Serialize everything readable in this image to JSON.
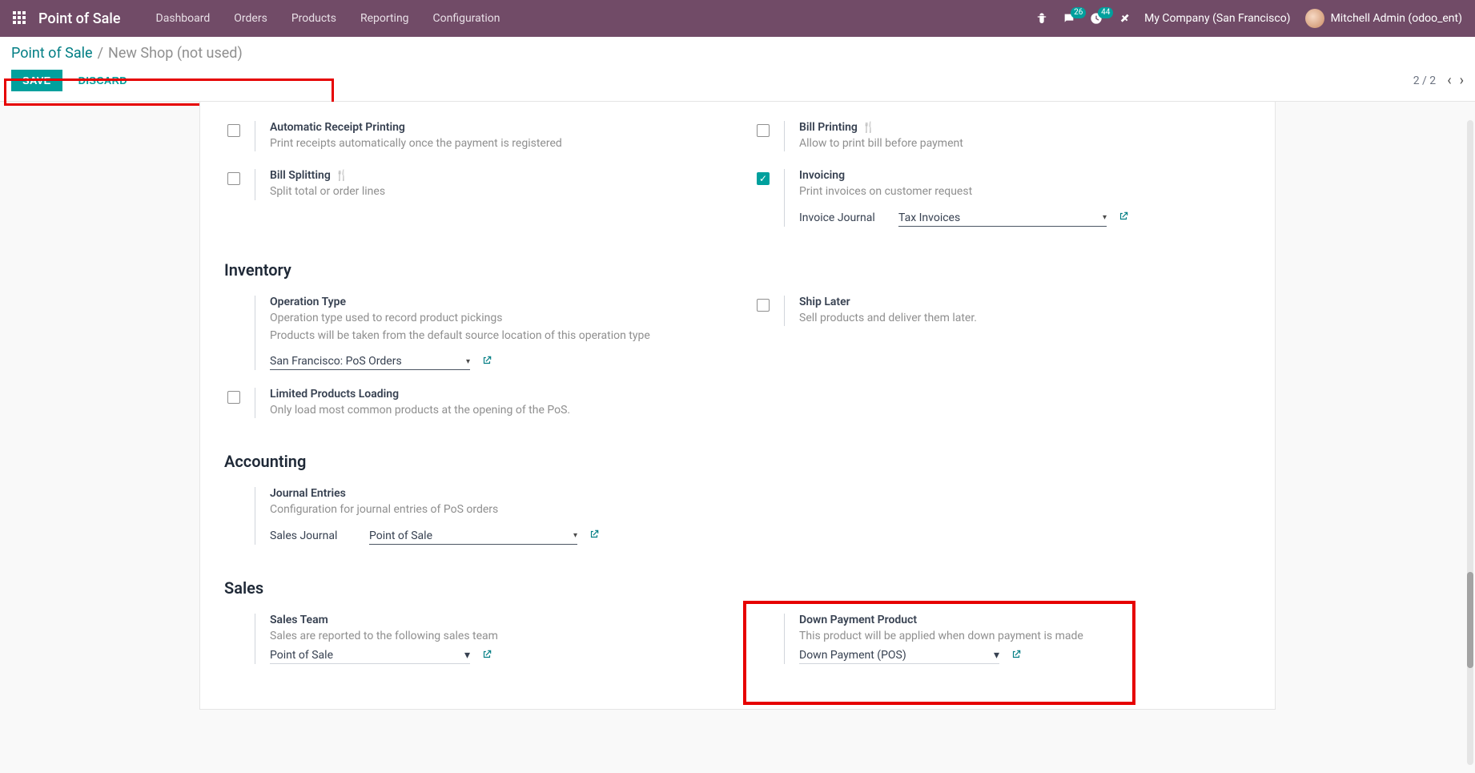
{
  "nav": {
    "brand": "Point of Sale",
    "menu": [
      "Dashboard",
      "Orders",
      "Products",
      "Reporting",
      "Configuration"
    ],
    "msg_count": "26",
    "act_count": "44",
    "company": "My Company (San Francisco)",
    "user": "Mitchell Admin (odoo_ent)"
  },
  "breadcrumb": {
    "root": "Point of Sale",
    "leaf": "New Shop (not used)"
  },
  "buttons": {
    "save": "SAVE",
    "discard": "DISCARD"
  },
  "pager": {
    "text": "2 / 2"
  },
  "settings": {
    "auto_receipt": {
      "title": "Automatic Receipt Printing",
      "desc": "Print receipts automatically once the payment is registered"
    },
    "bill_print": {
      "title": "Bill Printing",
      "desc": "Allow to print bill before payment"
    },
    "bill_split": {
      "title": "Bill Splitting",
      "desc": "Split total or order lines"
    },
    "invoicing": {
      "title": "Invoicing",
      "desc": "Print invoices on customer request",
      "journal_label": "Invoice Journal",
      "journal_value": "Tax Invoices"
    },
    "sections": {
      "inventory": "Inventory",
      "accounting": "Accounting",
      "sales": "Sales"
    },
    "op_type": {
      "title": "Operation Type",
      "desc1": "Operation type used to record product pickings",
      "desc2": "Products will be taken from the default source location of this operation type",
      "value": "San Francisco: PoS Orders"
    },
    "ship_later": {
      "title": "Ship Later",
      "desc": "Sell products and deliver them later."
    },
    "limited": {
      "title": "Limited Products Loading",
      "desc": "Only load most common products at the opening of the PoS."
    },
    "journal_entries": {
      "title": "Journal Entries",
      "desc": "Configuration for journal entries of PoS orders",
      "sales_journal_label": "Sales Journal",
      "sales_journal_value": "Point of Sale"
    },
    "sales_team": {
      "title": "Sales Team",
      "desc": "Sales are reported to the following sales team",
      "value": "Point of Sale"
    },
    "down_payment": {
      "title": "Down Payment Product",
      "desc": "This product will be applied when down payment is made",
      "value": "Down Payment (POS)"
    }
  }
}
